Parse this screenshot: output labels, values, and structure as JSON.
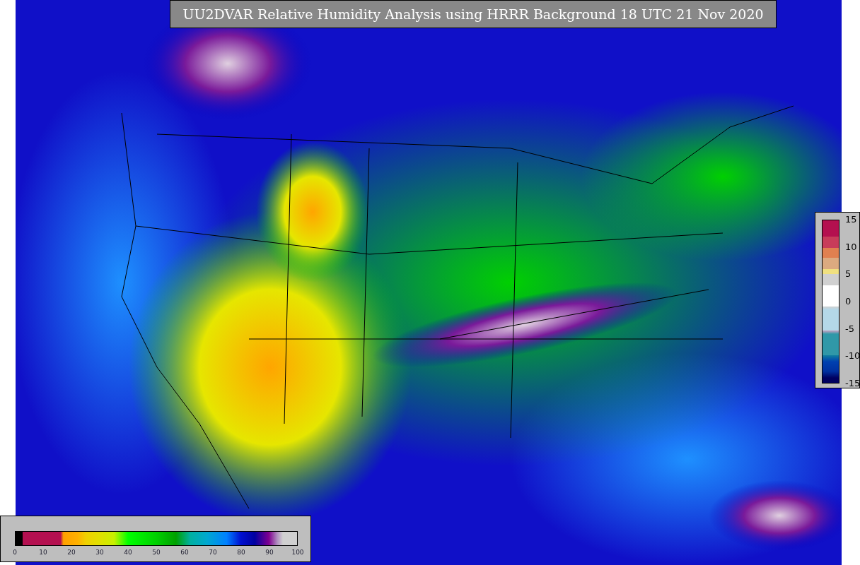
{
  "title": "UU2DVAR Relative Humidity Analysis using HRRR Background 18 UTC 21 Nov 2020",
  "humidity_colorbar": {
    "ticks": [
      "0",
      "10",
      "20",
      "30",
      "40",
      "50",
      "60",
      "70",
      "80",
      "90",
      "100"
    ]
  },
  "difference_colorbar": {
    "ticks": [
      "15",
      "10",
      "5",
      "0",
      "-5",
      "-10",
      "-15"
    ]
  }
}
